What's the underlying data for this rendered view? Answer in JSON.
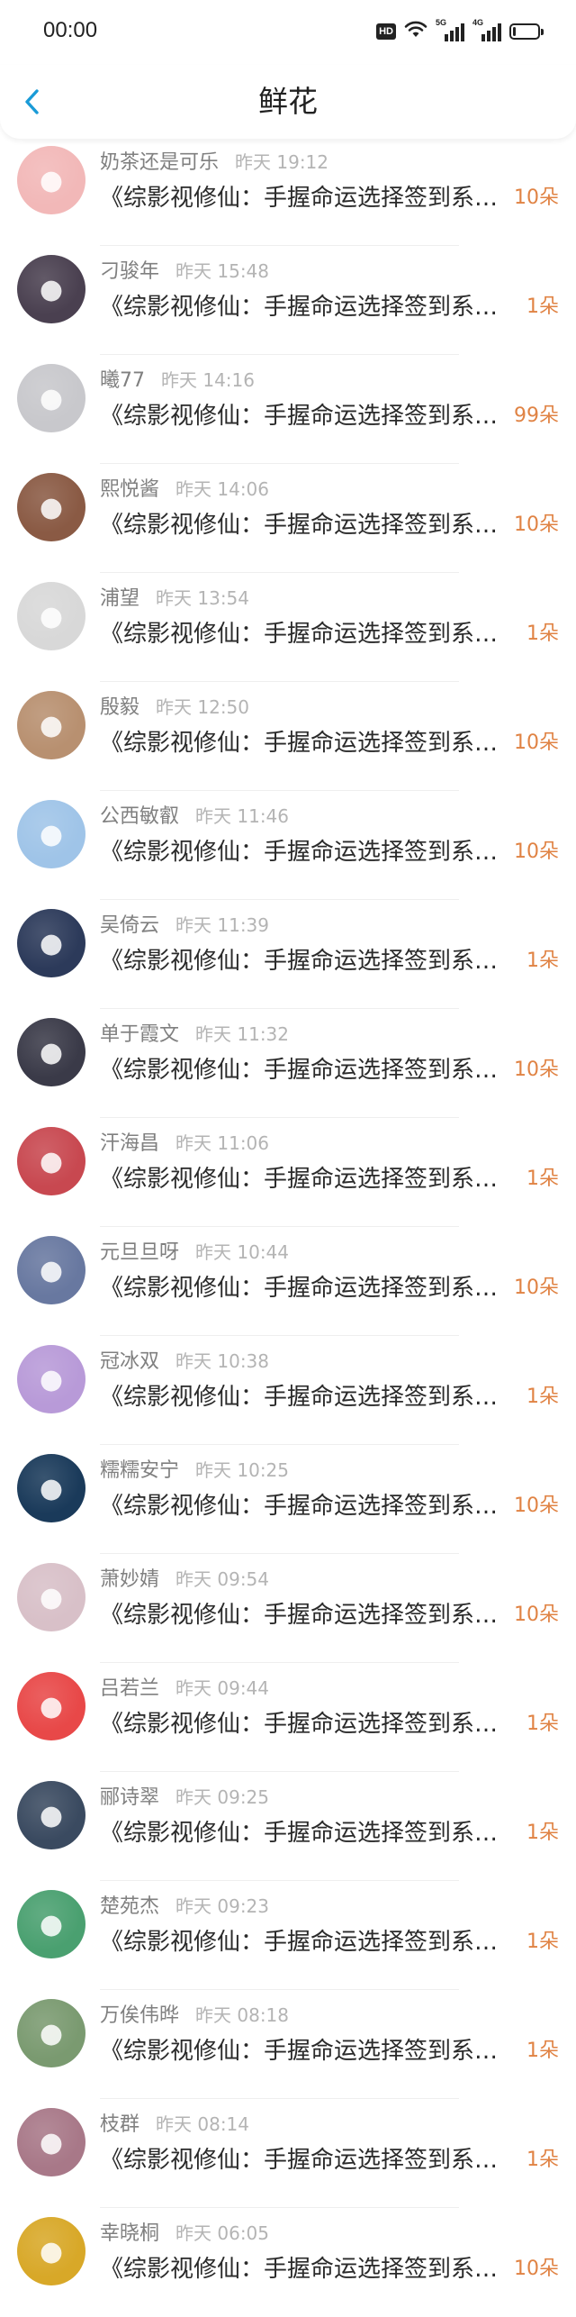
{
  "status_bar": {
    "time": "00:00",
    "hd_label": "HD",
    "sig1_label": "5G",
    "sig2_label": "4G",
    "battery_level": 0.12
  },
  "header": {
    "back_icon": "chevron-left-icon",
    "title": "鲜花"
  },
  "colors": {
    "accent": "#1a9bd7",
    "amount": "#e08344",
    "name": "#808080",
    "time": "#b4b4b4"
  },
  "rows": [
    {
      "name": "奶茶还是可乐",
      "time": "昨天 19:12",
      "content": "《综影视修仙：手握命运选择签到系统》",
      "amount": "10朵",
      "avatar_color": "#f2b8b8"
    },
    {
      "name": "刁骏年",
      "time": "昨天 15:48",
      "content": "《综影视修仙：手握命运选择签到系统》",
      "amount": "1朵",
      "avatar_color": "#4a4050"
    },
    {
      "name": "曦77",
      "time": "昨天 14:16",
      "content": "《综影视修仙：手握命运选择签到系统》",
      "amount": "99朵",
      "avatar_color": "#c8c8cc"
    },
    {
      "name": "熙悦酱",
      "time": "昨天 14:06",
      "content": "《综影视修仙：手握命运选择签到系统》",
      "amount": "10朵",
      "avatar_color": "#8a5a44"
    },
    {
      "name": "浦望",
      "time": "昨天 13:54",
      "content": "《综影视修仙：手握命运选择签到系统》",
      "amount": "1朵",
      "avatar_color": "#d8d8d8"
    },
    {
      "name": "殷毅",
      "time": "昨天 12:50",
      "content": "《综影视修仙：手握命运选择签到系统》",
      "amount": "10朵",
      "avatar_color": "#b89070"
    },
    {
      "name": "公西敏叡",
      "time": "昨天 11:46",
      "content": "《综影视修仙：手握命运选择签到系统》",
      "amount": "10朵",
      "avatar_color": "#9fc4e8"
    },
    {
      "name": "吴倚云",
      "time": "昨天 11:39",
      "content": "《综影视修仙：手握命运选择签到系统》",
      "amount": "1朵",
      "avatar_color": "#2c3a5a"
    },
    {
      "name": "单于霞文",
      "time": "昨天 11:32",
      "content": "《综影视修仙：手握命运选择签到系统》",
      "amount": "10朵",
      "avatar_color": "#3a3a48"
    },
    {
      "name": "汗海昌",
      "time": "昨天 11:06",
      "content": "《综影视修仙：手握命运选择签到系统》",
      "amount": "1朵",
      "avatar_color": "#c84850"
    },
    {
      "name": "元旦旦呀",
      "time": "昨天 10:44",
      "content": "《综影视修仙：手握命运选择签到系统》",
      "amount": "10朵",
      "avatar_color": "#6878a0"
    },
    {
      "name": "冠冰双",
      "time": "昨天 10:38",
      "content": "《综影视修仙：手握命运选择签到系统》",
      "amount": "1朵",
      "avatar_color": "#b89ad8"
    },
    {
      "name": "糯糯安宁",
      "time": "昨天 10:25",
      "content": "《综影视修仙：手握命运选择签到系统》",
      "amount": "10朵",
      "avatar_color": "#1a3a5a"
    },
    {
      "name": "萧妙婧",
      "time": "昨天 09:54",
      "content": "《综影视修仙：手握命运选择签到系统》",
      "amount": "10朵",
      "avatar_color": "#d8c0c8"
    },
    {
      "name": "吕若兰",
      "time": "昨天 09:44",
      "content": "《综影视修仙：手握命运选择签到系统》",
      "amount": "1朵",
      "avatar_color": "#e84848"
    },
    {
      "name": "郦诗翠",
      "time": "昨天 09:25",
      "content": "《综影视修仙：手握命运选择签到系统》",
      "amount": "1朵",
      "avatar_color": "#3a4a60"
    },
    {
      "name": "楚苑杰",
      "time": "昨天 09:23",
      "content": "《综影视修仙：手握命运选择签到系统》",
      "amount": "1朵",
      "avatar_color": "#4aa070"
    },
    {
      "name": "万俟伟晔",
      "time": "昨天 08:18",
      "content": "《综影视修仙：手握命运选择签到系统》",
      "amount": "1朵",
      "avatar_color": "#7a9a70"
    },
    {
      "name": "枝群",
      "time": "昨天 08:14",
      "content": "《综影视修仙：手握命运选择签到系统》",
      "amount": "1朵",
      "avatar_color": "#a87888"
    },
    {
      "name": "幸晓桐",
      "time": "昨天 06:05",
      "content": "《综影视修仙：手握命运选择签到系统》",
      "amount": "10朵",
      "avatar_color": "#d8a828"
    }
  ]
}
